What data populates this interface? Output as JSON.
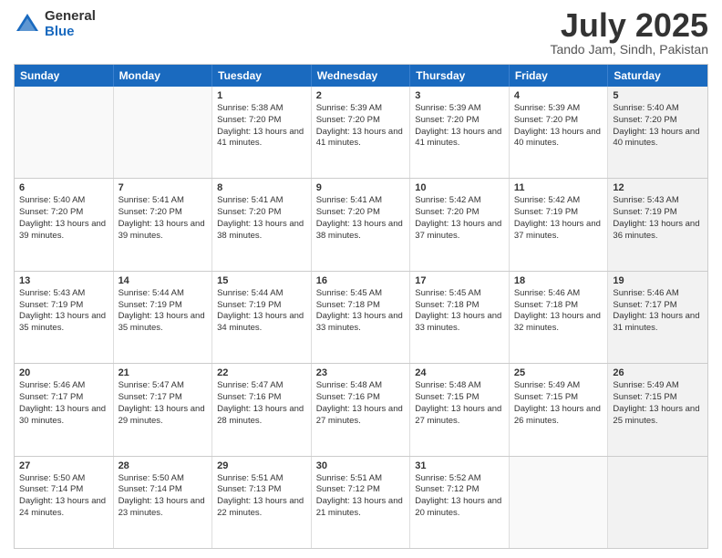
{
  "header": {
    "logo_general": "General",
    "logo_blue": "Blue",
    "title": "July 2025",
    "location": "Tando Jam, Sindh, Pakistan"
  },
  "days_of_week": [
    "Sunday",
    "Monday",
    "Tuesday",
    "Wednesday",
    "Thursday",
    "Friday",
    "Saturday"
  ],
  "weeks": [
    [
      {
        "day": "",
        "detail": "",
        "empty": true
      },
      {
        "day": "",
        "detail": "",
        "empty": true
      },
      {
        "day": "1",
        "detail": "Sunrise: 5:38 AM\nSunset: 7:20 PM\nDaylight: 13 hours\nand 41 minutes."
      },
      {
        "day": "2",
        "detail": "Sunrise: 5:39 AM\nSunset: 7:20 PM\nDaylight: 13 hours\nand 41 minutes."
      },
      {
        "day": "3",
        "detail": "Sunrise: 5:39 AM\nSunset: 7:20 PM\nDaylight: 13 hours\nand 41 minutes."
      },
      {
        "day": "4",
        "detail": "Sunrise: 5:39 AM\nSunset: 7:20 PM\nDaylight: 13 hours\nand 40 minutes."
      },
      {
        "day": "5",
        "detail": "Sunrise: 5:40 AM\nSunset: 7:20 PM\nDaylight: 13 hours\nand 40 minutes.",
        "shaded": true
      }
    ],
    [
      {
        "day": "6",
        "detail": "Sunrise: 5:40 AM\nSunset: 7:20 PM\nDaylight: 13 hours\nand 39 minutes."
      },
      {
        "day": "7",
        "detail": "Sunrise: 5:41 AM\nSunset: 7:20 PM\nDaylight: 13 hours\nand 39 minutes."
      },
      {
        "day": "8",
        "detail": "Sunrise: 5:41 AM\nSunset: 7:20 PM\nDaylight: 13 hours\nand 38 minutes."
      },
      {
        "day": "9",
        "detail": "Sunrise: 5:41 AM\nSunset: 7:20 PM\nDaylight: 13 hours\nand 38 minutes."
      },
      {
        "day": "10",
        "detail": "Sunrise: 5:42 AM\nSunset: 7:20 PM\nDaylight: 13 hours\nand 37 minutes."
      },
      {
        "day": "11",
        "detail": "Sunrise: 5:42 AM\nSunset: 7:19 PM\nDaylight: 13 hours\nand 37 minutes."
      },
      {
        "day": "12",
        "detail": "Sunrise: 5:43 AM\nSunset: 7:19 PM\nDaylight: 13 hours\nand 36 minutes.",
        "shaded": true
      }
    ],
    [
      {
        "day": "13",
        "detail": "Sunrise: 5:43 AM\nSunset: 7:19 PM\nDaylight: 13 hours\nand 35 minutes."
      },
      {
        "day": "14",
        "detail": "Sunrise: 5:44 AM\nSunset: 7:19 PM\nDaylight: 13 hours\nand 35 minutes."
      },
      {
        "day": "15",
        "detail": "Sunrise: 5:44 AM\nSunset: 7:19 PM\nDaylight: 13 hours\nand 34 minutes."
      },
      {
        "day": "16",
        "detail": "Sunrise: 5:45 AM\nSunset: 7:18 PM\nDaylight: 13 hours\nand 33 minutes."
      },
      {
        "day": "17",
        "detail": "Sunrise: 5:45 AM\nSunset: 7:18 PM\nDaylight: 13 hours\nand 33 minutes."
      },
      {
        "day": "18",
        "detail": "Sunrise: 5:46 AM\nSunset: 7:18 PM\nDaylight: 13 hours\nand 32 minutes."
      },
      {
        "day": "19",
        "detail": "Sunrise: 5:46 AM\nSunset: 7:17 PM\nDaylight: 13 hours\nand 31 minutes.",
        "shaded": true
      }
    ],
    [
      {
        "day": "20",
        "detail": "Sunrise: 5:46 AM\nSunset: 7:17 PM\nDaylight: 13 hours\nand 30 minutes."
      },
      {
        "day": "21",
        "detail": "Sunrise: 5:47 AM\nSunset: 7:17 PM\nDaylight: 13 hours\nand 29 minutes."
      },
      {
        "day": "22",
        "detail": "Sunrise: 5:47 AM\nSunset: 7:16 PM\nDaylight: 13 hours\nand 28 minutes."
      },
      {
        "day": "23",
        "detail": "Sunrise: 5:48 AM\nSunset: 7:16 PM\nDaylight: 13 hours\nand 27 minutes."
      },
      {
        "day": "24",
        "detail": "Sunrise: 5:48 AM\nSunset: 7:15 PM\nDaylight: 13 hours\nand 27 minutes."
      },
      {
        "day": "25",
        "detail": "Sunrise: 5:49 AM\nSunset: 7:15 PM\nDaylight: 13 hours\nand 26 minutes."
      },
      {
        "day": "26",
        "detail": "Sunrise: 5:49 AM\nSunset: 7:15 PM\nDaylight: 13 hours\nand 25 minutes.",
        "shaded": true
      }
    ],
    [
      {
        "day": "27",
        "detail": "Sunrise: 5:50 AM\nSunset: 7:14 PM\nDaylight: 13 hours\nand 24 minutes."
      },
      {
        "day": "28",
        "detail": "Sunrise: 5:50 AM\nSunset: 7:14 PM\nDaylight: 13 hours\nand 23 minutes."
      },
      {
        "day": "29",
        "detail": "Sunrise: 5:51 AM\nSunset: 7:13 PM\nDaylight: 13 hours\nand 22 minutes."
      },
      {
        "day": "30",
        "detail": "Sunrise: 5:51 AM\nSunset: 7:12 PM\nDaylight: 13 hours\nand 21 minutes."
      },
      {
        "day": "31",
        "detail": "Sunrise: 5:52 AM\nSunset: 7:12 PM\nDaylight: 13 hours\nand 20 minutes."
      },
      {
        "day": "",
        "detail": "",
        "empty": true
      },
      {
        "day": "",
        "detail": "",
        "empty": true,
        "shaded": true
      }
    ]
  ]
}
